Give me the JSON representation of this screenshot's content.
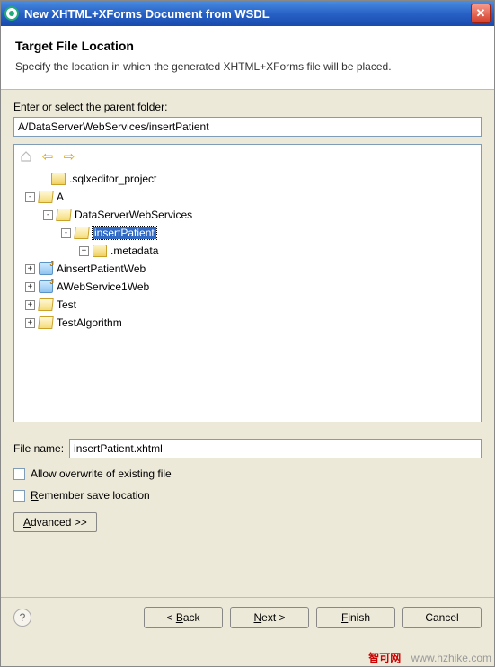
{
  "title": "New XHTML+XForms Document from WSDL",
  "header": {
    "title": "Target File Location",
    "description": "Specify the location in which the generated XHTML+XForms file will be placed."
  },
  "parentFolder": {
    "label": "Enter or select the parent folder:",
    "value": "A/DataServerWebServices/insertPatient"
  },
  "tree": {
    "nodes": [
      {
        "indent": 20,
        "expander": "",
        "icon": "folder-closed",
        "label": ".sqlxeditor_project"
      },
      {
        "indent": 6,
        "expander": "-",
        "icon": "folder-open",
        "label": "A"
      },
      {
        "indent": 26,
        "expander": "-",
        "icon": "folder-open",
        "label": "DataServerWebServices"
      },
      {
        "indent": 46,
        "expander": "-",
        "icon": "folder-open",
        "label": "insertPatient",
        "selected": true
      },
      {
        "indent": 66,
        "expander": "+",
        "icon": "folder-closed",
        "label": ".metadata"
      },
      {
        "indent": 6,
        "expander": "+",
        "icon": "project",
        "label": "AinsertPatientWeb"
      },
      {
        "indent": 6,
        "expander": "+",
        "icon": "project",
        "label": "AWebService1Web"
      },
      {
        "indent": 6,
        "expander": "+",
        "icon": "folder-open",
        "label": "Test"
      },
      {
        "indent": 6,
        "expander": "+",
        "icon": "folder-open",
        "label": "TestAlgorithm"
      }
    ]
  },
  "filename": {
    "label": "File name:",
    "value": "insertPatient.xhtml"
  },
  "checks": {
    "overwrite": "Allow overwrite of existing file",
    "remember": "Remember save location"
  },
  "advanced": "Advanced >>",
  "buttons": {
    "back": "< Back",
    "next": "Next >",
    "finish": "Finish",
    "cancel": "Cancel"
  },
  "watermark": {
    "brand": "智可网",
    "url": "www.hzhike.com"
  }
}
